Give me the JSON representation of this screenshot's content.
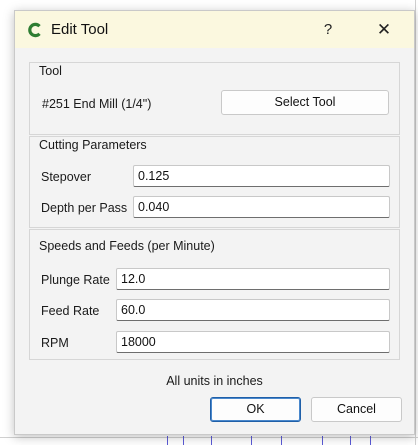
{
  "dialog": {
    "title": "Edit Tool",
    "help_glyph": "?",
    "close_glyph": "✕",
    "accent_color": "#2e7d32"
  },
  "tool_group": {
    "title": "Tool",
    "tool_name": "#251 End Mill (1/4\")",
    "select_button": "Select Tool"
  },
  "cutting_group": {
    "title": "Cutting Parameters",
    "stepover_label": "Stepover",
    "stepover_value": "0.125",
    "depth_label": "Depth per Pass",
    "depth_value": "0.040"
  },
  "speeds_group": {
    "title": "Speeds and Feeds (per Minute)",
    "plunge_label": "Plunge Rate",
    "plunge_value": "12.0",
    "feed_label": "Feed Rate",
    "feed_value": "60.0",
    "rpm_label": "RPM",
    "rpm_value": "18000"
  },
  "footer": {
    "units_note": "All units in inches",
    "ok_label": "OK",
    "cancel_label": "Cancel"
  }
}
